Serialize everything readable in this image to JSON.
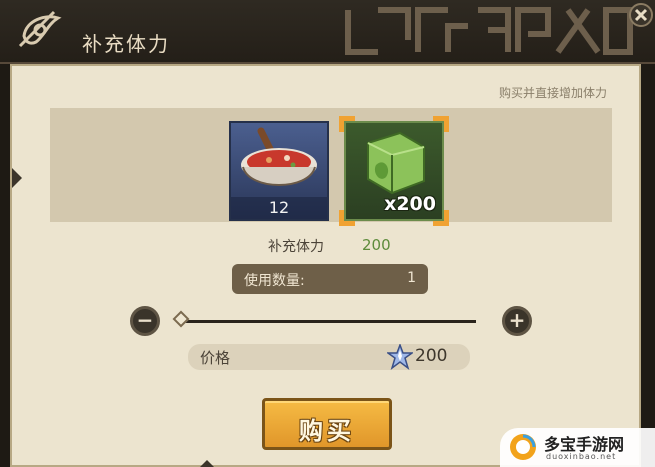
{
  "window": {
    "title": "补充体力",
    "hint": "购买并直接增加体力"
  },
  "items": [
    {
      "name": "food",
      "count": "12",
      "icon": "ramen-bowl-icon"
    },
    {
      "name": "stamina-pack",
      "quantity": "x200",
      "icon": "green-cube-icon",
      "selected": true
    }
  ],
  "stat": {
    "label": "补充体力",
    "value": "200"
  },
  "quantity": {
    "label": "使用数量:",
    "value": "1"
  },
  "slider": {
    "min_icon": "minus-icon",
    "max_icon": "plus-icon",
    "level": 0.0
  },
  "price": {
    "label": "价格",
    "value": "200",
    "icon": "crystal-icon"
  },
  "buy_button": {
    "label": "购买"
  },
  "watermark": {
    "text": "多宝手游网",
    "url": "duoxinbao.net"
  },
  "colors": {
    "accent": "#f0a232",
    "stat_value": "#5d8b3a",
    "panel": "#ece4cf"
  }
}
